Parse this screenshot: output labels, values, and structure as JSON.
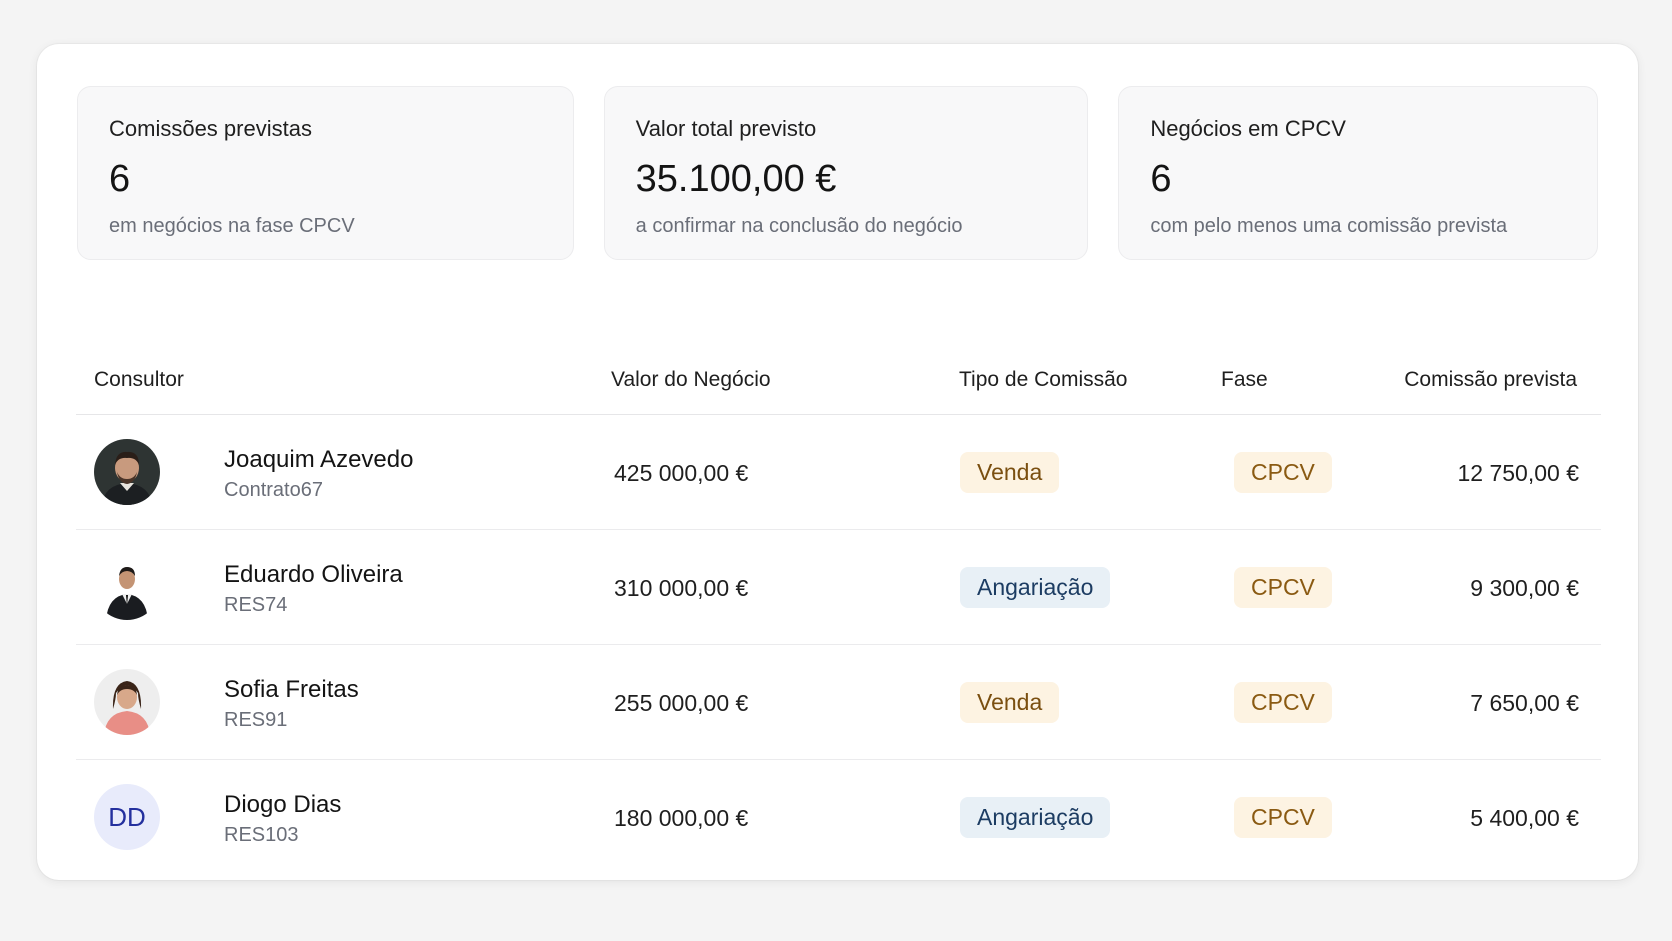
{
  "stats": [
    {
      "title": "Comissões previstas",
      "value": "6",
      "subtitle": "em negócios na fase CPCV"
    },
    {
      "title": "Valor total previsto",
      "value": "35.100,00 €",
      "subtitle": "a confirmar na conclusão do negócio"
    },
    {
      "title": "Negócios em CPCV",
      "value": "6",
      "subtitle": "com pelo menos uma comissão prevista"
    }
  ],
  "table": {
    "headers": {
      "consultor": "Consultor",
      "valor": "Valor do Negócio",
      "tipo": "Tipo de Comissão",
      "fase": "Fase",
      "comissao": "Comissão prevista"
    },
    "rows": [
      {
        "name": "Joaquim Azevedo",
        "code": "Contrato67",
        "avatar": "photo-avatar",
        "valor": "425 000,00 €",
        "tipo": "Venda",
        "tipo_kind": "venda",
        "fase": "CPCV",
        "comissao": "12 750,00 €"
      },
      {
        "name": "Eduardo Oliveira",
        "code": "RES74",
        "avatar": "photo-avatar",
        "valor": "310 000,00 €",
        "tipo": "Angariação",
        "tipo_kind": "angariacao",
        "fase": "CPCV",
        "comissao": "9 300,00 €"
      },
      {
        "name": "Sofia Freitas",
        "code": "RES91",
        "avatar": "photo-avatar",
        "valor": "255 000,00 €",
        "tipo": "Venda",
        "tipo_kind": "venda",
        "fase": "CPCV",
        "comissao": "7 650,00 €"
      },
      {
        "name": "Diogo Dias",
        "code": "RES103",
        "avatar_initials": "DD",
        "valor": "180 000,00 €",
        "tipo": "Angariação",
        "tipo_kind": "angariacao",
        "fase": "CPCV",
        "comissao": "5 400,00 €"
      }
    ]
  },
  "colors": {
    "badge_venda_bg": "#fdf3e2",
    "badge_venda_text": "#7a4f10",
    "badge_angariacao_bg": "#e8f0f6",
    "badge_angariacao_text": "#1c3c62",
    "avatar_initials_bg": "#e8ebfb",
    "avatar_initials_text": "#24309e"
  }
}
